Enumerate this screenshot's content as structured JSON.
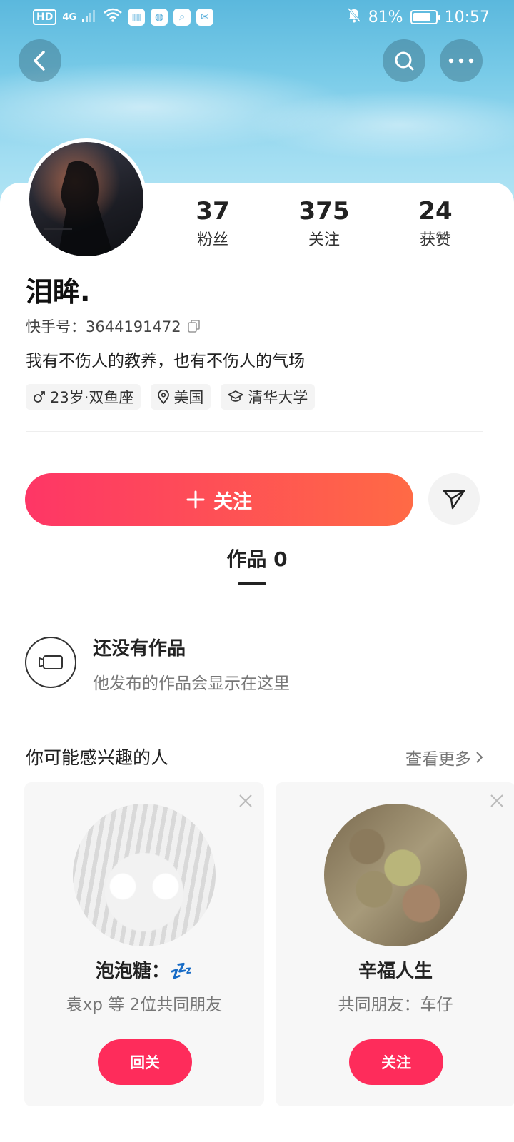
{
  "status_bar": {
    "network": "HD",
    "signal": "4G",
    "battery_pct": "81%",
    "battery_level": 0.81,
    "time": "10:57"
  },
  "profile": {
    "stats": [
      {
        "value": "37",
        "label": "粉丝"
      },
      {
        "value": "375",
        "label": "关注"
      },
      {
        "value": "24",
        "label": "获赞"
      }
    ],
    "name": "泪眸.",
    "id_text": "快手号：3644191472",
    "bio": "我有不伤人的教养，也有不伤人的气场",
    "tags": [
      {
        "icon": "male-icon",
        "text": "23岁·双鱼座"
      },
      {
        "icon": "location-icon",
        "text": "美国"
      },
      {
        "icon": "school-icon",
        "text": "清华大学"
      }
    ]
  },
  "actions": {
    "follow_label": "关注",
    "share_icon": "paper-plane-icon"
  },
  "tabs": {
    "works_label": "作品 0"
  },
  "empty_state": {
    "title": "还没有作品",
    "subtitle": "他发布的作品会显示在这里"
  },
  "recommendations": {
    "title": "你可能感兴趣的人",
    "more_label": "查看更多",
    "users": [
      {
        "name": "泡泡糖：💤",
        "subtitle": "袁xp 等 2位共同朋友",
        "button": "回关"
      },
      {
        "name": "辛福人生",
        "subtitle": "共同朋友：车仔",
        "button": "关注"
      }
    ]
  },
  "colors": {
    "accent": "#fe2c5b",
    "follow_gradient_start": "#fe3666",
    "follow_gradient_end": "#ff6a45",
    "banner": "#79cbe8"
  }
}
